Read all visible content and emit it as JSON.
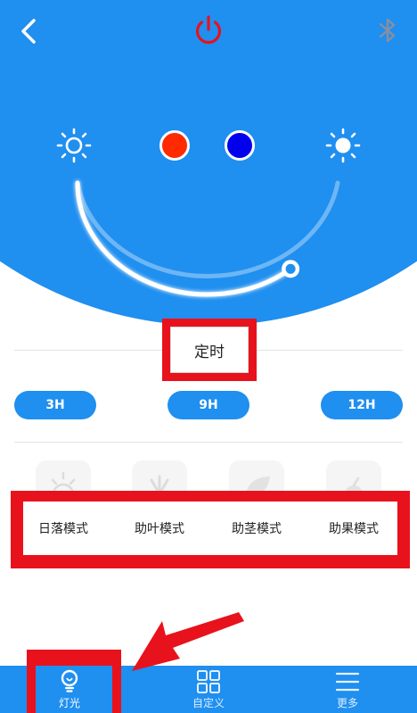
{
  "header": {
    "back_icon": "chevron-left-icon",
    "power_icon": "power-icon",
    "bluetooth_icon": "bluetooth-icon"
  },
  "controls": {
    "brightness_low_icon": "sun-outline-icon",
    "brightness_high_icon": "sun-filled-icon",
    "colors": {
      "red": "#ff2a00",
      "blue": "#0000ee"
    },
    "slider_level": 0.72
  },
  "timer": {
    "title": "定时",
    "options": [
      "3H",
      "9H",
      "12H"
    ]
  },
  "modes": {
    "items": [
      "日落模式",
      "助叶模式",
      "助茎模式",
      "助果模式"
    ]
  },
  "nav": {
    "items": [
      {
        "label": "灯光",
        "icon": "bulb-icon"
      },
      {
        "label": "自定义",
        "icon": "grid-icon"
      },
      {
        "label": "更多",
        "icon": "menu-icon"
      }
    ]
  },
  "theme": {
    "primary": "#1f8ff0",
    "accent_red": "#e8121c"
  }
}
